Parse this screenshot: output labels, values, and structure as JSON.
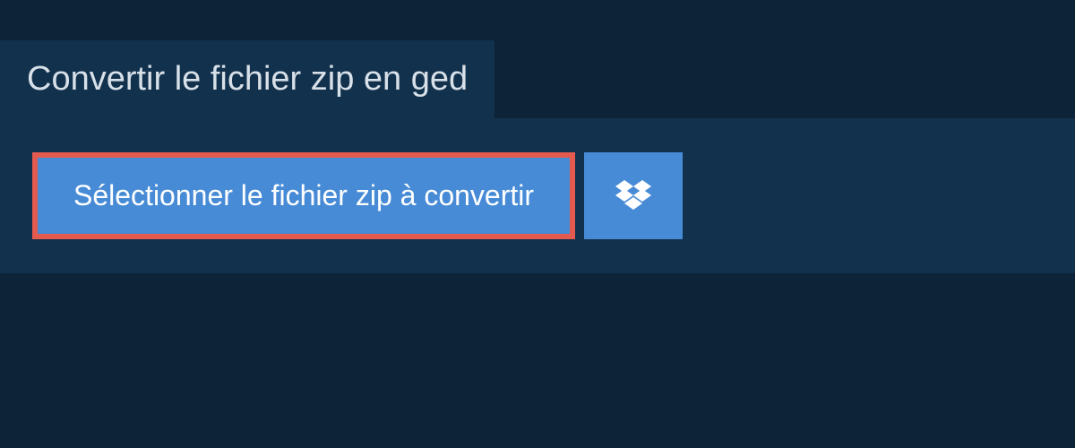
{
  "header": {
    "title": "Convertir le fichier zip en ged"
  },
  "actions": {
    "select_file_label": "Sélectionner le fichier zip à convertir",
    "dropbox_icon": "dropbox"
  },
  "colors": {
    "background_dark": "#0d2438",
    "panel": "#11314d",
    "button_blue": "#478bd6",
    "highlight_border": "#e55a4f",
    "text_light": "#d8e0e8",
    "text_white": "#ffffff"
  }
}
